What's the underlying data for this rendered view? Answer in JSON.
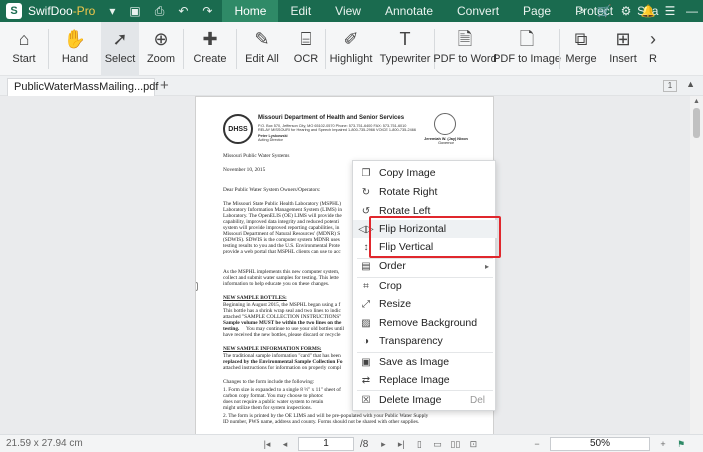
{
  "app": {
    "name": "SwifDoo",
    "edition": "-Pro",
    "logo_letter": "S"
  },
  "titlebar": {
    "menu_tabs": [
      "Home",
      "Edit",
      "View",
      "Annotate",
      "Convert",
      "Page",
      "Protect",
      "Sha"
    ],
    "active_tab": "Home",
    "more_glyph": ">"
  },
  "ribbon": {
    "start": "Start",
    "hand": "Hand",
    "select": "Select",
    "zoom": "Zoom",
    "create": "Create",
    "edit_all": "Edit All",
    "ocr": "OCR",
    "highlight": "Highlight",
    "typewriter": "Typewriter",
    "pdf_to_word": "PDF to Word",
    "pdf_to_image": "PDF to Image",
    "merge": "Merge",
    "insert": "Insert",
    "overflow": "R"
  },
  "tabs": {
    "document": "PublicWaterMassMailing...pdf *",
    "page_indicator": "1"
  },
  "document": {
    "dept": "Missouri Department of Health and Senior Services",
    "lh1": "P.O. Box 570, Jefferson City, MO 65102-0570   Phone: 573-751-6400   FAX: 573-751-6010",
    "lh2": "RELAY MISSOURI for Hearing and Speech Impaired 1-800-735-2966   VOICE 1-800-735-2466",
    "director": "Peter Lyskowski",
    "director_title": "Acting Director",
    "governor": "Jeremiah W. (Jay) Nixon",
    "governor_title": "Governor",
    "seal_text": "DHSS",
    "p1": "Missouri Public Water Systems",
    "p2": "November 10, 2015",
    "p3": "Dear Public Water System Owners/Operators:",
    "body1": [
      "The Missouri State Public Health Laboratory (MSPHL)",
      "Laboratory Information Management System (LIMS) in",
      "Laboratory. The OpenELIS (OE) LIMS will provide the",
      "capability, improved data integrity and reduced potenti",
      "system will provide improved reporting capabilities, in",
      "Missouri Department of Natural Resources' (MDNR) S",
      "(SDWIS). SDWIS is the computer system MDNR uses",
      "testing results to you and the U.S. Environmental Prote",
      "provide a web portal that MSPHL clients can use to acc"
    ],
    "body2": [
      "As the MSPHL implements this new computer system,",
      "collect and submit water samples for testing. This lette",
      "information to help educate you on these changes."
    ],
    "h1": "NEW SAMPLE BOTTLES:",
    "body3": [
      "Beginning in August 2015, the MSPHL began using a f",
      "This bottle has a shrink wrap seal and two lines to indic",
      "attached \"SAMPLE COLLECTION INSTRUCTIONS\""
    ],
    "body3b": "Sample volume MUST be within the two lines on the",
    "body3c": "testing.",
    "body3d": [
      "You may continue to use your old bottles until",
      "have received the new bottles, please discard or recycle"
    ],
    "h2": "NEW SAMPLE INFORMATION FORMS:",
    "body4": [
      "The traditional sample information \"card\" that has been",
      "replaced by the Environmental Sample Collection Fo",
      "attached instructions for information on properly compl"
    ],
    "body5": "Changes to the form include the following:",
    "body6": [
      "1.  Form size is expanded to a single 8 ½\" x 11\" sheet of",
      "     carbon copy format.  You may choose to photoc",
      "     does not require a public water system to retain",
      "     might utilize them for system inspections.",
      "2.  The form is printed by the OE LIMS and will be pre-populated with your Public Water Supply",
      "     ID number, PWS name, address and county. Forms should not be shared with other supplies."
    ]
  },
  "context_menu": {
    "items": [
      {
        "label": "Copy Image",
        "icon": "copy-icon",
        "glyph": "❐"
      },
      {
        "label": "Rotate Right",
        "icon": "rotate-right-icon",
        "glyph": "↻"
      },
      {
        "label": "Rotate Left",
        "icon": "rotate-left-icon",
        "glyph": "↺"
      },
      {
        "label": "Flip Horizontal",
        "icon": "flip-horizontal-icon",
        "glyph": "◁▷"
      },
      {
        "label": "Flip Vertical",
        "icon": "flip-vertical-icon",
        "glyph": "↕"
      },
      {
        "label": "Order",
        "icon": "order-icon",
        "glyph": "▤",
        "submenu": "▸"
      },
      {
        "label": "Crop",
        "icon": "crop-icon",
        "glyph": "⌗"
      },
      {
        "label": "Resize",
        "icon": "resize-icon",
        "glyph": "⤢"
      },
      {
        "label": "Remove Background",
        "icon": "remove-background-icon",
        "glyph": "▨"
      },
      {
        "label": "Transparency",
        "icon": "transparency-icon",
        "glyph": "◑"
      },
      {
        "label": "Save as Image",
        "icon": "save-image-icon",
        "glyph": "▣"
      },
      {
        "label": "Replace Image",
        "icon": "replace-image-icon",
        "glyph": "⇄"
      },
      {
        "label": "Delete Image",
        "icon": "trash-icon",
        "glyph": "☒",
        "shortcut": "Del"
      }
    ]
  },
  "statusbar": {
    "dimensions": "21.59 x 27.94 cm",
    "current_page": "1",
    "total_pages": "/8",
    "zoom": "50%"
  },
  "colors": {
    "brand": "#1a6b4f",
    "highlight_box": "#e0272d"
  }
}
